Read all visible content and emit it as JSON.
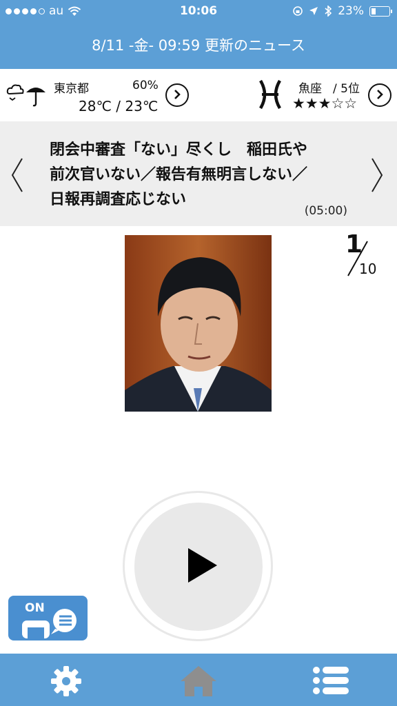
{
  "status": {
    "carrier": "au",
    "time": "10:06",
    "battery": "23%",
    "battery_level": 0.23
  },
  "header": {
    "title": "8/11 -金- 09:59 更新のニュース"
  },
  "weather": {
    "location": "東京都",
    "precip": "60%",
    "temps": "28℃ / 23℃"
  },
  "horoscope": {
    "sign": "魚座",
    "rank": "/ 5位",
    "stars": "★★★☆☆",
    "rating": 3
  },
  "news": {
    "headline_line1": "閉会中審査「ない」尽くし　稲田氏や",
    "headline_line2": "前次官いない／報告有無明言しない／",
    "headline_line3": "日報再調査応じない",
    "time": "(05:00)",
    "index": "1",
    "total": "10"
  },
  "player": {
    "on_label": "ON"
  },
  "colors": {
    "header_blue": "#5c9fd6",
    "badge_blue": "#4a8fd0",
    "headline_bg": "#eeeeee"
  },
  "icons": {
    "settings": "gear-icon",
    "home": "home-icon",
    "menu": "list-icon",
    "weather": "cloudy-rain-icon",
    "sign": "pisces-icon"
  }
}
